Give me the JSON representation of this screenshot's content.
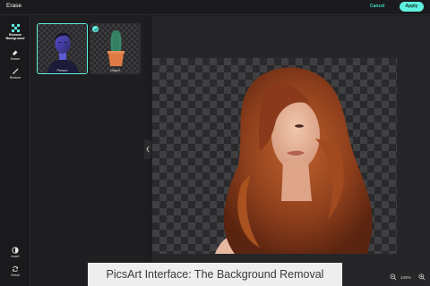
{
  "header": {
    "title": "Erase",
    "cancel_label": "Cancel",
    "apply_label": "Apply"
  },
  "tools": {
    "remove_background": "Remove Background",
    "eraser": "Eraser",
    "restore": "Restore",
    "invert": "Invert",
    "reset": "Reset"
  },
  "thumbnails": [
    {
      "label": "Person"
    },
    {
      "label": "Object"
    }
  ],
  "caption": "PicsArt Interface: The Background Removal",
  "zoom": {
    "level": "125%"
  },
  "colors": {
    "accent": "#5ff0df",
    "background": "#1d1d1f"
  },
  "icons": [
    "checkerboard-icon",
    "eraser-icon",
    "brush-icon",
    "invert-icon",
    "reset-icon",
    "chevron-left-icon",
    "zoom-out-icon",
    "zoom-in-icon"
  ]
}
